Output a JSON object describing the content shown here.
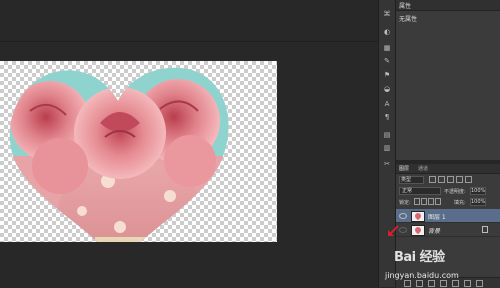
{
  "properties_panel": {
    "tab_label": "属性",
    "subtitle": "无属性"
  },
  "layers_panel": {
    "tabs": [
      "图层",
      "通道"
    ],
    "kind_label": "类型",
    "blend_mode": "正常",
    "opacity_label": "不透明度:",
    "opacity_value": "100%",
    "lock_label": "锁定:",
    "fill_label": "填充:",
    "fill_value": "100%",
    "layers": [
      {
        "name": "图层 1",
        "selected": true
      },
      {
        "name": "背景",
        "selected": false
      }
    ]
  },
  "watermark": {
    "brand": "Bai 经验",
    "url": "jingyan.baidu.com"
  },
  "colors": {
    "canvas_bg": "#282828",
    "panel_bg": "#3b3b3b",
    "selection": "#5a6e8c",
    "rose_pink": "#e58a91",
    "arrow_red": "#d2202f"
  }
}
